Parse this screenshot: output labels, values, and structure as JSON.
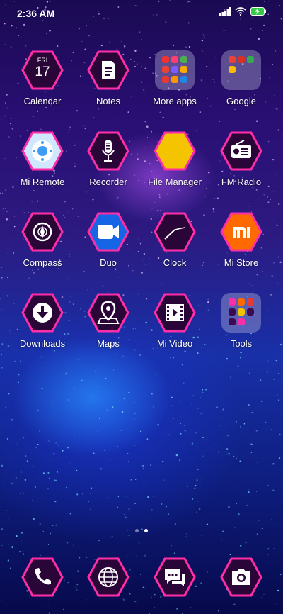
{
  "status": {
    "time": "2:36 AM"
  },
  "calendar": {
    "weekday": "FRI",
    "day": "17"
  },
  "apps": {
    "calendar": "Calendar",
    "notes": "Notes",
    "more_apps": "More apps",
    "google": "Google",
    "mi_remote": "Mi Remote",
    "recorder": "Recorder",
    "file_manager": "File Manager",
    "fm_radio": "FM Radio",
    "compass": "Compass",
    "duo": "Duo",
    "clock": "Clock",
    "mi_store": "Mi Store",
    "downloads": "Downloads",
    "maps": "Maps",
    "mi_video": "Mi Video",
    "tools": "Tools"
  },
  "dock": [
    "phone-icon",
    "browser-icon",
    "messaging-icon",
    "camera-icon"
  ],
  "pages": {
    "count": 2,
    "active": 2
  },
  "colors": {
    "hex_border": "#ff2ea8",
    "hex_fill": "#2a0638",
    "file_manager_fill": "#f5c400",
    "mi_store_fill": "#ff6a00",
    "duo_fill": "#1565e6"
  }
}
